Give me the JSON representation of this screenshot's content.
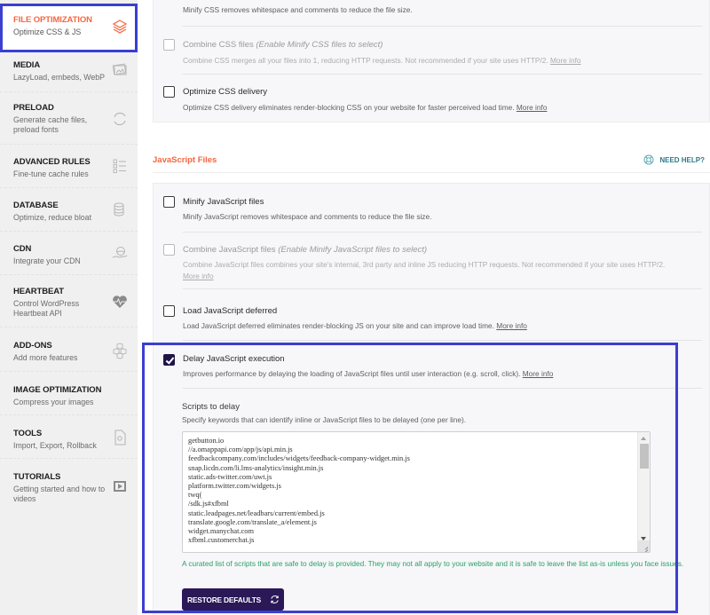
{
  "colors": {
    "accent": "#f56640",
    "highlight_border": "#3b3fd0",
    "primary_button": "#2a1857",
    "note_green": "#27a067",
    "help_teal": "#2b7b8a"
  },
  "sidebar": {
    "items": [
      {
        "title": "FILE OPTIMIZATION",
        "subtitle": "Optimize CSS & JS",
        "icon": "layers-icon",
        "active": true
      },
      {
        "title": "MEDIA",
        "subtitle": "LazyLoad, embeds, WebP",
        "icon": "images-icon"
      },
      {
        "title": "PRELOAD",
        "subtitle": "Generate cache files, preload fonts",
        "icon": "refresh-icon"
      },
      {
        "title": "ADVANCED RULES",
        "subtitle": "Fine-tune cache rules",
        "icon": "checklist-icon"
      },
      {
        "title": "DATABASE",
        "subtitle": "Optimize, reduce bloat",
        "icon": "database-icon"
      },
      {
        "title": "CDN",
        "subtitle": "Integrate your CDN",
        "icon": "globe-hand-icon"
      },
      {
        "title": "HEARTBEAT",
        "subtitle": "Control WordPress Heartbeat API",
        "icon": "heartbeat-icon"
      },
      {
        "title": "ADD-ONS",
        "subtitle": "Add more features",
        "icon": "cubes-icon"
      },
      {
        "title": "IMAGE OPTIMIZATION",
        "subtitle": "Compress your images",
        "icon": ""
      },
      {
        "title": "TOOLS",
        "subtitle": "Import, Export, Rollback",
        "icon": "gear-file-icon"
      },
      {
        "title": "TUTORIALS",
        "subtitle": "Getting started and how to videos",
        "icon": "play-icon"
      }
    ]
  },
  "css_section": {
    "options": [
      {
        "label": "",
        "description": "Minify CSS removes whitespace and comments to reduce the file size.",
        "more_info": ""
      },
      {
        "label": "Combine CSS files",
        "label_note": "(Enable Minify CSS files to select)",
        "description": "Combine CSS merges all your files into 1, reducing HTTP requests. Not recommended if your site uses HTTP/2.",
        "more_info": "More info",
        "disabled": true,
        "checked": false
      },
      {
        "label": "Optimize CSS delivery",
        "description": "Optimize CSS delivery eliminates render-blocking CSS on your website for faster perceived load time.",
        "more_info": "More info",
        "checked": false
      }
    ]
  },
  "js_section": {
    "title": "JavaScript Files",
    "need_help": "NEED HELP?",
    "options": [
      {
        "label": "Minify JavaScript files",
        "description": "Minify JavaScript removes whitespace and comments to reduce the file size.",
        "checked": false
      },
      {
        "label": "Combine JavaScript files",
        "label_note": "(Enable Minify JavaScript files to select)",
        "description": "Combine JavaScript files combines your site's internal, 3rd party and inline JS reducing HTTP requests. Not recommended if your site uses HTTP/2.",
        "more_info": "More info",
        "disabled": true,
        "checked": false
      },
      {
        "label": "Load JavaScript deferred",
        "description": "Load JavaScript deferred eliminates render-blocking JS on your site and can improve load time.",
        "more_info": "More info",
        "checked": false
      },
      {
        "label": "Delay JavaScript execution",
        "description": "Improves performance by delaying the loading of JavaScript files until user interaction (e.g. scroll, click).",
        "more_info": "More info",
        "checked": true
      }
    ],
    "scripts_to_delay": {
      "title": "Scripts to delay",
      "description": "Specify keywords that can identify inline or JavaScript files to be delayed (one per line).",
      "lines": [
        "getbutton.io",
        "//a.omappapi.com/app/js/api.min.js",
        "feedbackcompany.com/includes/widgets/feedback-company-widget.min.js",
        "snap.licdn.com/li.lms-analytics/insight.min.js",
        "static.ads-twitter.com/uwt.js",
        "platform.twitter.com/widgets.js",
        "twq(",
        "/sdk.js#xfbml",
        "static.leadpages.net/leadbars/current/embed.js",
        "translate.google.com/translate_a/element.js",
        "widget.manychat.com",
        "xfbml.customerchat.js"
      ],
      "note": "A curated list of scripts that are safe to delay is provided. They may not all apply to your website and it is safe to leave the list as-is unless you face issues.",
      "restore_button": "RESTORE DEFAULTS"
    }
  }
}
